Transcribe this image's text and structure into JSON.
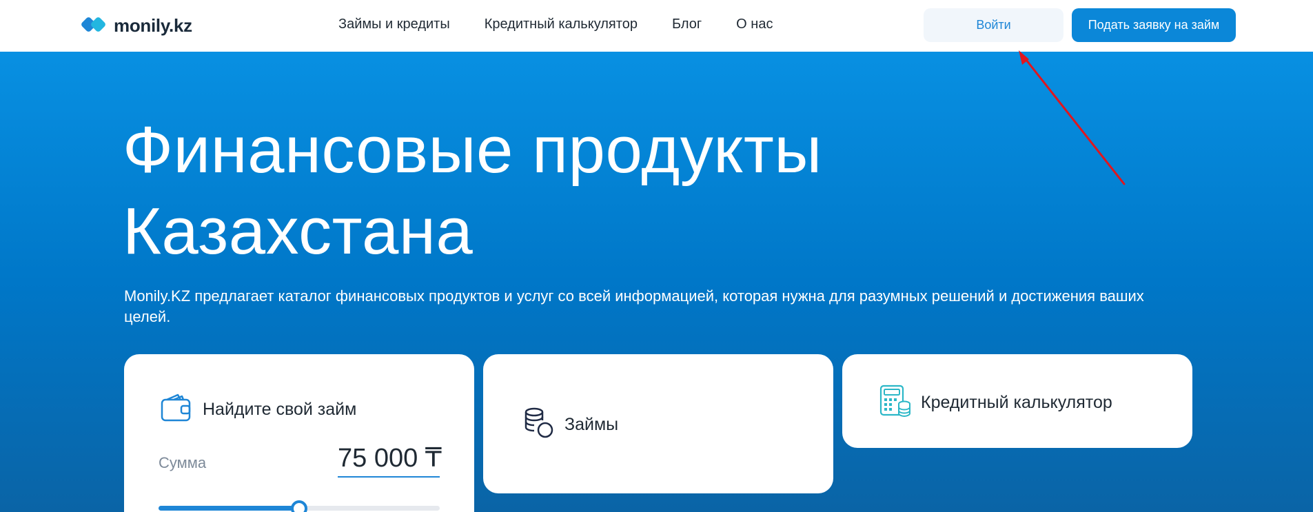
{
  "header": {
    "logo_text": "monily.kz",
    "nav": [
      {
        "label": "Займы и кредиты"
      },
      {
        "label": "Кредитный калькулятор"
      },
      {
        "label": "Блог"
      },
      {
        "label": "О нас"
      }
    ],
    "login_label": "Войти",
    "apply_label": "Подать заявку на займ"
  },
  "hero": {
    "title_line1": "Финансовые продукты",
    "title_line2": "Казахстана",
    "description": "Monily.KZ предлагает каталог финансовых продуктов и услуг со всей информацией, которая нужна для разумных решений и достижения ваших целей."
  },
  "cards": {
    "loan_finder": {
      "title": "Найдите свой займ",
      "sum_label": "Сумма",
      "sum_value": "75 000 ₸",
      "slider_fraction": 0.5
    },
    "loans": {
      "title": "Займы"
    },
    "calculator": {
      "title": "Кредитный калькулятор"
    }
  },
  "colors": {
    "accent": "#1e86d6",
    "hero_top": "#0890e2",
    "hero_bottom": "#0a64a6",
    "arrow": "#e0161e"
  }
}
